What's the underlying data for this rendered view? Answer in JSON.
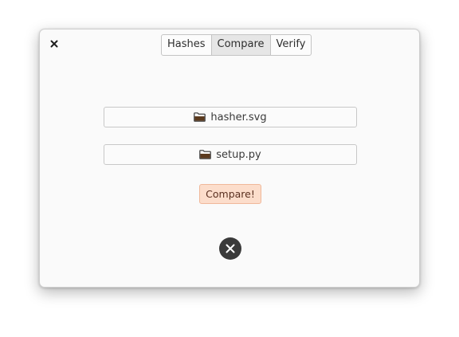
{
  "window": {
    "close_icon": "close-icon"
  },
  "tabs": [
    {
      "label": "Hashes",
      "active": false
    },
    {
      "label": "Compare",
      "active": true
    },
    {
      "label": "Verify",
      "active": false
    }
  ],
  "compare": {
    "file1": {
      "label": "hasher.svg",
      "icon": "folder-icon"
    },
    "file2": {
      "label": "setup.py",
      "icon": "folder-icon"
    },
    "compare_button_label": "Compare!",
    "result_icon": "error-circle-icon"
  },
  "colors": {
    "accent_bg": "#fcddcb",
    "accent_border": "#f0b89a",
    "folder": "#5b3a1e",
    "result_icon_bg": "#3a3a3a"
  }
}
